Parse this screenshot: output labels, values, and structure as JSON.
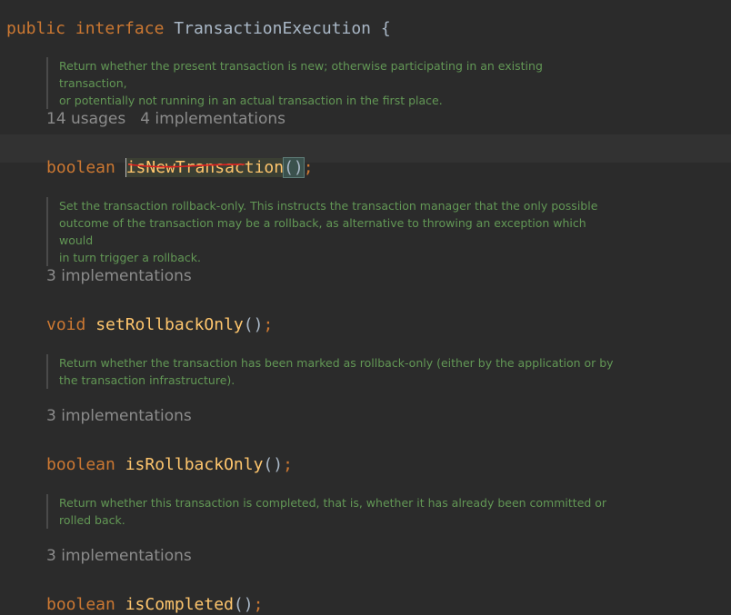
{
  "header": {
    "kw_public": "public",
    "kw_interface": "interface",
    "name": "TransactionExecution",
    "brace": "{"
  },
  "members": [
    {
      "doc": [
        "Return whether the present transaction is new; otherwise participating in an existing transaction,",
        "or potentially not running in an actual transaction in the first place."
      ],
      "hint_usages": "14 usages",
      "hint_impl": "4 implementations",
      "return_type": "boolean",
      "method": "isNewTransaction",
      "parens": "()",
      "semi": ";"
    },
    {
      "doc": [
        "Set the transaction rollback-only. This instructs the transaction manager that the only possible",
        "outcome of the transaction may be a rollback, as alternative to throwing an exception which would",
        "in turn trigger a rollback."
      ],
      "hint_impl": "3 implementations",
      "return_type": "void",
      "method": "setRollbackOnly",
      "parens": "()",
      "semi": ";"
    },
    {
      "doc": [
        "Return whether the transaction has been marked as rollback-only (either by the application or by",
        "the transaction infrastructure)."
      ],
      "hint_impl": "3 implementations",
      "return_type": "boolean",
      "method": "isRollbackOnly",
      "parens": "()",
      "semi": ";"
    },
    {
      "doc": [
        "Return whether this transaction is completed, that is, whether it has already been committed or",
        "rolled back."
      ],
      "hint_impl": "3 implementations",
      "return_type": "boolean",
      "method": "isCompleted",
      "parens": "()",
      "semi": ";"
    }
  ],
  "colors": {
    "background": "#2b2b2b",
    "keyword": "#cc7832",
    "method": "#ffc66d",
    "doc": "#629755",
    "hint": "#8c8c8c",
    "error_underline": "#e02020"
  }
}
